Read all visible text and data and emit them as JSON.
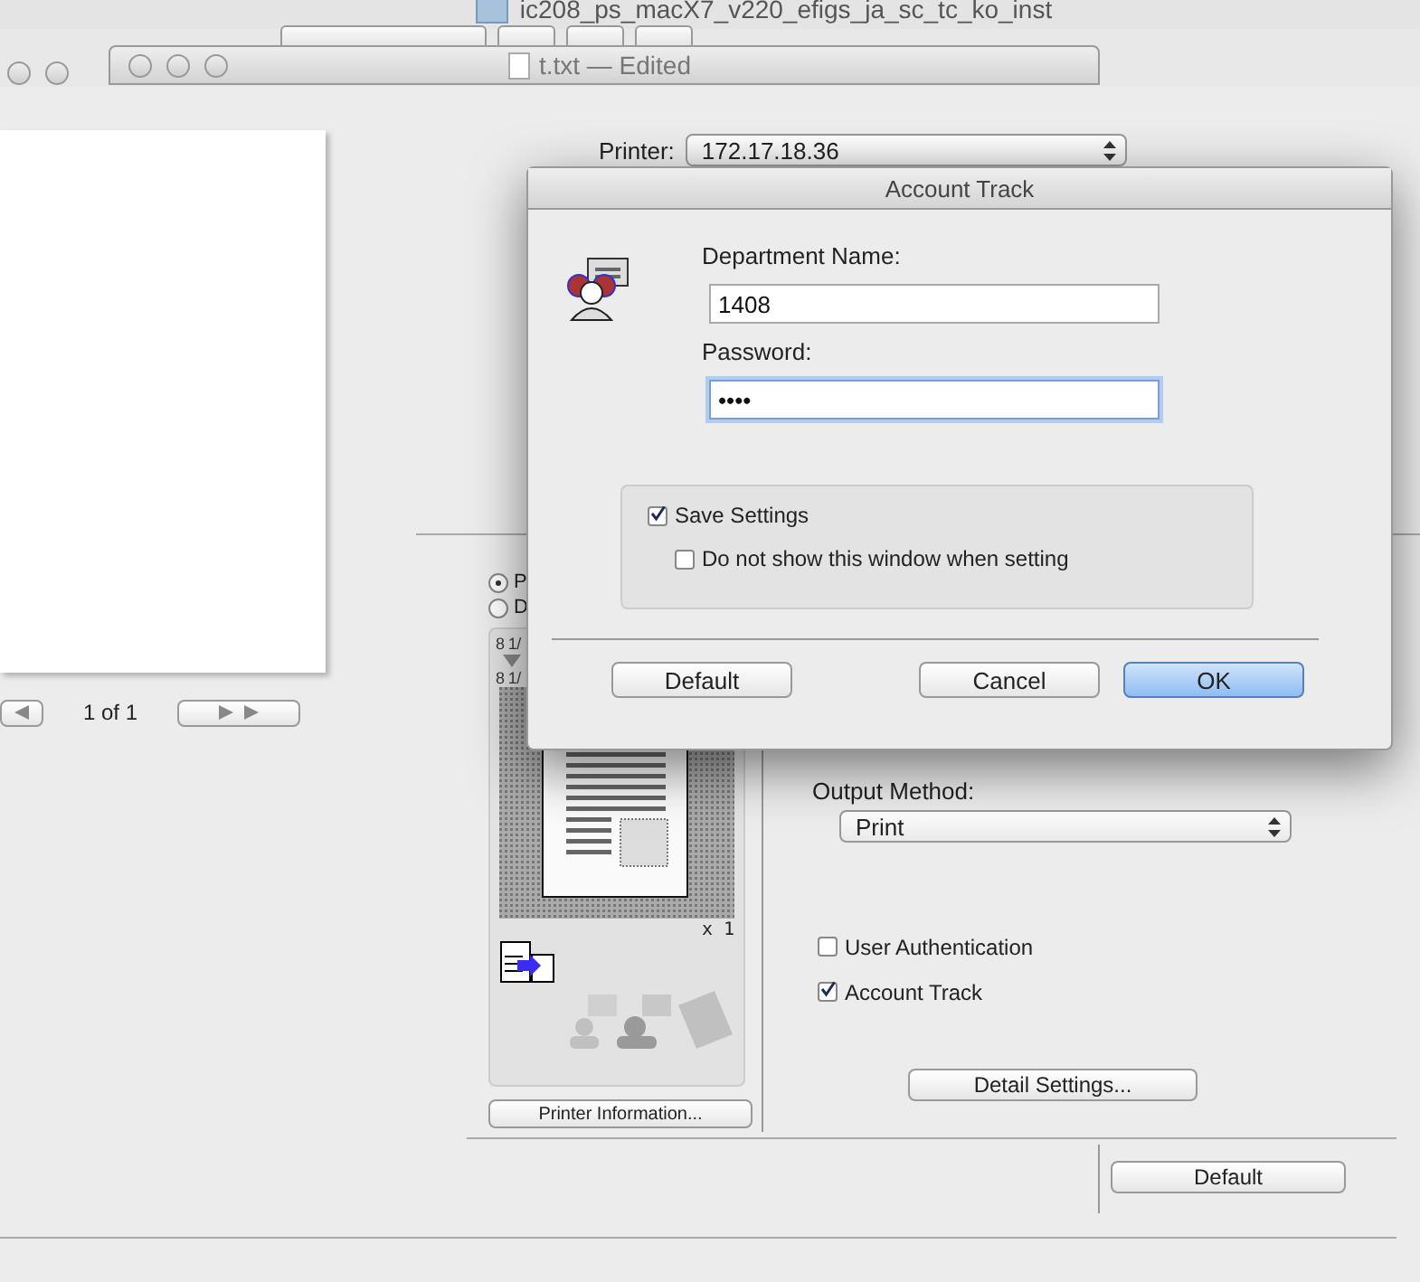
{
  "finder_window": {
    "title": "ic208_ps_macX7_v220_efigs_ja_sc_tc_ko_inst"
  },
  "editor_window": {
    "title": "t.txt — Edited"
  },
  "print_sheet": {
    "printer_label": "Printer:",
    "printer": "172.17.18.36",
    "page_indicator": "1 of 1",
    "radio_options": [
      {
        "label": "P",
        "selected": true
      },
      {
        "label": "D",
        "selected": false
      }
    ],
    "preview": {
      "size_top": "8 1/",
      "size_bottom": "8 1/",
      "copies": "x 1"
    },
    "printer_info_button": "Printer Information...",
    "output_method_label": "Output Method:",
    "output_method": "Print",
    "checkboxes": [
      {
        "label": "User Authentication",
        "checked": false
      },
      {
        "label": "Account Track",
        "checked": true
      }
    ],
    "detail_button": "Detail Settings...",
    "default_button": "Default"
  },
  "dialog": {
    "title": "Account Track",
    "fields": [
      {
        "label": "Department Name:",
        "value": "1408",
        "focused": false
      },
      {
        "label": "Password:",
        "value": "••••",
        "focused": true
      }
    ],
    "options": [
      {
        "label": "Save Settings",
        "checked": true,
        "children": [
          {
            "label": "Do not show this window when setting",
            "checked": false
          }
        ]
      }
    ],
    "buttons": [
      {
        "label": "Default",
        "default": false
      },
      {
        "label": "Cancel",
        "default": false
      },
      {
        "label": "OK",
        "default": true
      }
    ]
  }
}
